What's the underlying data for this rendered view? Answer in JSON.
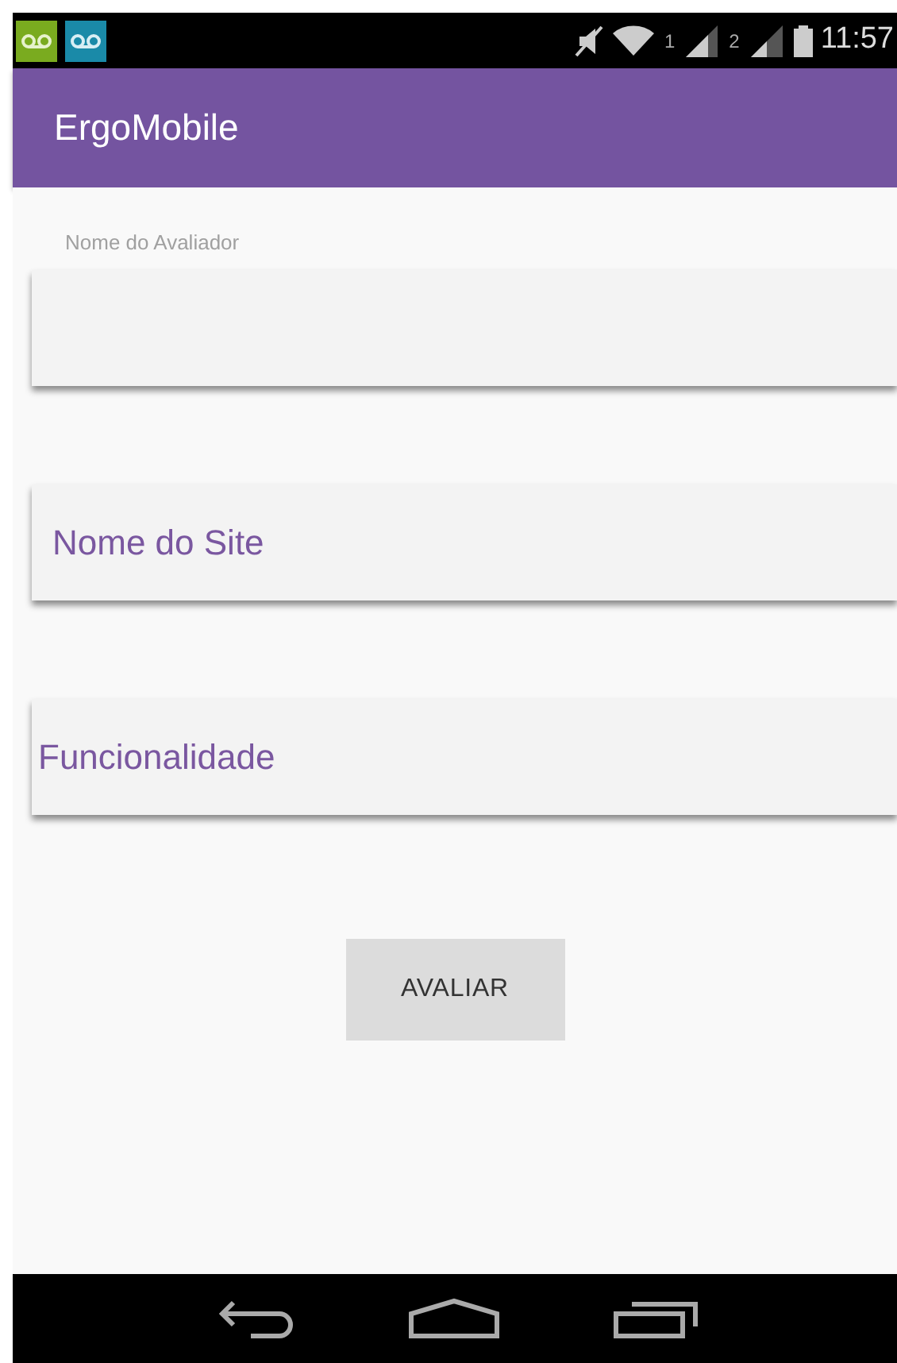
{
  "status_bar": {
    "sim_1": "1",
    "sim_2": "2",
    "time": "11:57"
  },
  "app_bar": {
    "title": "ErgoMobile"
  },
  "fields": [
    {
      "kind": "labeled",
      "label": "Nome do Avaliador"
    },
    {
      "kind": "hint",
      "placeholder": "Nome do Site"
    },
    {
      "kind": "hint",
      "placeholder": "Funcionalidade"
    }
  ],
  "button": "AVALIAR"
}
